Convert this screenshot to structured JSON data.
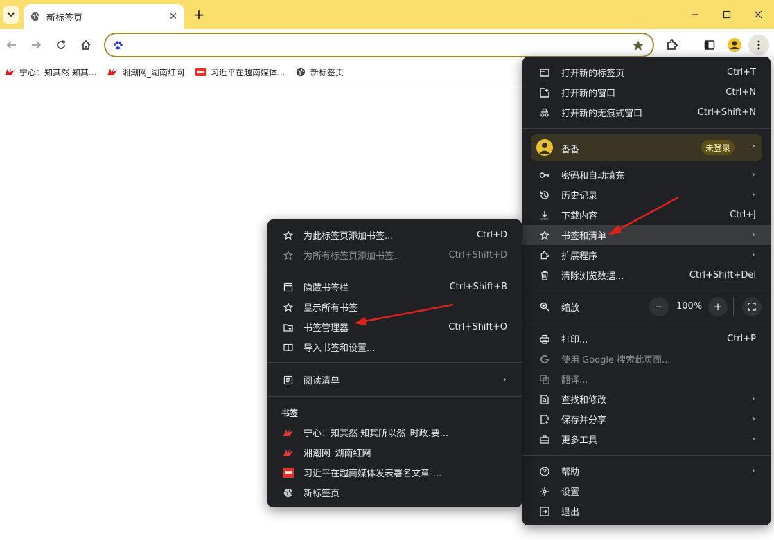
{
  "tab": {
    "title": "新标签页",
    "close_glyph": "✕"
  },
  "newtab": {
    "glyph": "+"
  },
  "window": {
    "minimize": "—",
    "maximize": "☐",
    "close": "✕"
  },
  "toolbar": {
    "back": "←",
    "forward": "→",
    "reload": "↻",
    "home": "⌂",
    "menu": "⋮"
  },
  "bookmarks_bar": [
    {
      "label": "宁心：知其然 知其...",
      "icon": "red-fav-icon"
    },
    {
      "label": "湘潮网_湖南红网",
      "icon": "red-fav-icon"
    },
    {
      "label": "习近平在越南媒体...",
      "icon": "toutiao-fav-icon"
    },
    {
      "label": "新标签页",
      "icon": "globe-icon"
    }
  ],
  "main_menu": {
    "new_tab": {
      "label": "打开新的标签页",
      "shortcut": "Ctrl+T"
    },
    "new_window": {
      "label": "打开新的窗口",
      "shortcut": "Ctrl+N"
    },
    "incognito": {
      "label": "打开新的无痕式窗口",
      "shortcut": "Ctrl+Shift+N"
    },
    "profile": {
      "name": "香香",
      "badge": "未登录"
    },
    "passwords": {
      "label": "密码和自动填充"
    },
    "history": {
      "label": "历史记录"
    },
    "downloads": {
      "label": "下载内容",
      "shortcut": "Ctrl+J"
    },
    "bookmarks": {
      "label": "书签和清单"
    },
    "extensions": {
      "label": "扩展程序"
    },
    "clear_data": {
      "label": "清除浏览数据...",
      "shortcut": "Ctrl+Shift+Del"
    },
    "zoom": {
      "label": "缩放",
      "minus": "−",
      "value": "100%",
      "plus": "+"
    },
    "print": {
      "label": "打印...",
      "shortcut": "Ctrl+P"
    },
    "google_search": {
      "label": "使用 Google 搜索此页面..."
    },
    "translate": {
      "label": "翻译..."
    },
    "find_edit": {
      "label": "查找和修改"
    },
    "save_share": {
      "label": "保存并分享"
    },
    "more_tools": {
      "label": "更多工具"
    },
    "help": {
      "label": "帮助"
    },
    "settings": {
      "label": "设置"
    },
    "exit": {
      "label": "退出"
    }
  },
  "sub_menu": {
    "bookmark_tab": {
      "label": "为此标签页添加书签...",
      "shortcut": "Ctrl+D"
    },
    "bookmark_all": {
      "label": "为所有标签页添加书签...",
      "shortcut": "Ctrl+Shift+D"
    },
    "hide_bar": {
      "label": "隐藏书签栏",
      "shortcut": "Ctrl+Shift+B"
    },
    "show_all": {
      "label": "显示所有书签"
    },
    "manager": {
      "label": "书签管理器",
      "shortcut": "Ctrl+Shift+O"
    },
    "import": {
      "label": "导入书签和设置..."
    },
    "reading_list": {
      "label": "阅读清单"
    },
    "section_title": "书签",
    "items": [
      {
        "label": "宁心：知其然 知其所以然_时政.要..."
      },
      {
        "label": "湘潮网_湖南红网"
      },
      {
        "label": "习近平在越南媒体发表署名文章-..."
      },
      {
        "label": "新标签页"
      }
    ]
  },
  "arrow_glyph": "›",
  "colors": {
    "titlebar": "#fbdf6c",
    "menu_bg": "#202124",
    "annotation_arrow": "#e0201b",
    "omnibox_border": "#a08a2a"
  }
}
